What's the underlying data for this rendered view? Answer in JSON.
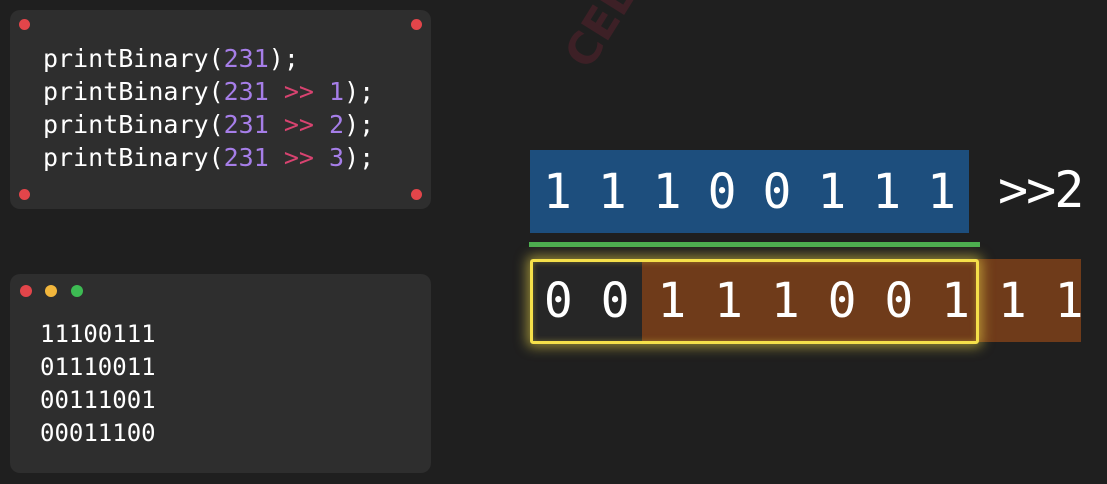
{
  "code": {
    "lines": [
      {
        "fn": "printBinary(",
        "num": "231",
        "op": "",
        "shift": "",
        "end": ");"
      },
      {
        "fn": "printBinary(",
        "num": "231",
        "op": ">>",
        "shift": "1",
        "end": ");"
      },
      {
        "fn": "printBinary(",
        "num": "231",
        "op": ">>",
        "shift": "2",
        "end": ");"
      },
      {
        "fn": "printBinary(",
        "num": "231",
        "op": ">>",
        "shift": "3",
        "end": ");"
      }
    ]
  },
  "output": {
    "lines": [
      "11100111",
      "01110011",
      "00111001",
      "00011100"
    ]
  },
  "visual": {
    "original_bits": [
      "1",
      "1",
      "1",
      "0",
      "0",
      "1",
      "1",
      "1"
    ],
    "shift_label": ">>2",
    "shifted_bits": [
      "0",
      "0",
      "1",
      "1",
      "1",
      "0",
      "0",
      "1",
      "1",
      "1"
    ]
  },
  "watermark": "CELEOSIO",
  "colors": {
    "background": "#1f1f1f",
    "panel": "#2e2e2e",
    "number": "#a67ee8",
    "operator": "#d84370",
    "original_fill": "#1d4e7d",
    "shifted_fill": "#6f3b1a",
    "divider": "#4cae50",
    "window_border": "#f5e04a",
    "dot_red": "#e2454a",
    "dot_yellow": "#f2b63c",
    "dot_green": "#3dbb53"
  }
}
